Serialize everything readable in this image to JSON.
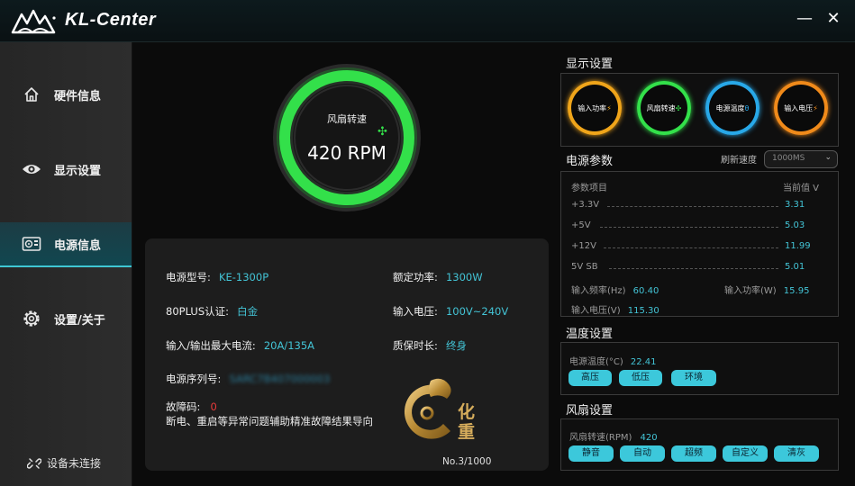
{
  "app": {
    "title": "KL-Center"
  },
  "window": {
    "minimize": "—",
    "close": "✕"
  },
  "sidebar": {
    "items": [
      {
        "label": "硬件信息",
        "icon": "home-icon"
      },
      {
        "label": "显示设置",
        "icon": "eye-icon"
      },
      {
        "label": "电源信息",
        "icon": "psu-icon"
      },
      {
        "label": "设置/关于",
        "icon": "gear-icon"
      }
    ],
    "active_index": 2,
    "status": "设备未连接"
  },
  "gauge": {
    "label": "风扇转速",
    "value": "420 RPM",
    "color": "#33e04a"
  },
  "psu": {
    "model_label": "电源型号:",
    "model_value": "KE-1300P",
    "rated_label": "额定功率:",
    "rated_value": "1300W",
    "cert_label": "80PLUS认证:",
    "cert_value": "白金",
    "input_v_label": "输入电压:",
    "input_v_value": "100V~240V",
    "current_label": "输入/输出最大电流:",
    "current_value": "20A/135A",
    "warranty_label": "质保时长:",
    "warranty_value": "终身",
    "serial_label": "电源序列号:",
    "serial_value": "SARC7B407000003",
    "fault_label": "故障码:",
    "fault_value": "0",
    "fault_note": "断电、重启等异常问题辅助精准故障结果导向",
    "badge_number": "No.3/1000",
    "badge_chars": "化重"
  },
  "display_settings": {
    "title": "显示设置",
    "rings": [
      {
        "label": "输入功率",
        "color": "#f0a51a",
        "glyph": "⚡"
      },
      {
        "label": "风扇转速",
        "color": "#33e04a",
        "glyph": "✣"
      },
      {
        "label": "电源温度",
        "color": "#28a8e8",
        "glyph": "θ"
      },
      {
        "label": "输入电压",
        "color": "#f08a1a",
        "glyph": "⚡"
      }
    ]
  },
  "power_params": {
    "title": "电源参数",
    "refresh_label": "刷新速度",
    "refresh_value": "1000MS",
    "col_item": "参数项目",
    "col_value": "当前值 V",
    "rows": [
      {
        "label": "+3.3V",
        "value": "3.31"
      },
      {
        "label": "+5V",
        "value": "5.03"
      },
      {
        "label": "+12V",
        "value": "11.99"
      },
      {
        "label": "5V SB",
        "value": "5.01"
      }
    ],
    "freq_label": "输入频率(Hz)",
    "freq_value": "60.40",
    "inpower_label": "输入功率(W)",
    "inpower_value": "15.95",
    "involt_label": "输入电压(V)",
    "involt_value": "115.30"
  },
  "temp_settings": {
    "title": "温度设置",
    "temp_label": "电源温度(°C)",
    "temp_value": "22.41",
    "buttons": [
      "高压",
      "低压",
      "环境"
    ]
  },
  "fan_settings": {
    "title": "风扇设置",
    "speed_label": "风扇转速(RPM)",
    "speed_value": "420",
    "buttons": [
      "静音",
      "自动",
      "超频",
      "自定义",
      "清灰"
    ]
  }
}
